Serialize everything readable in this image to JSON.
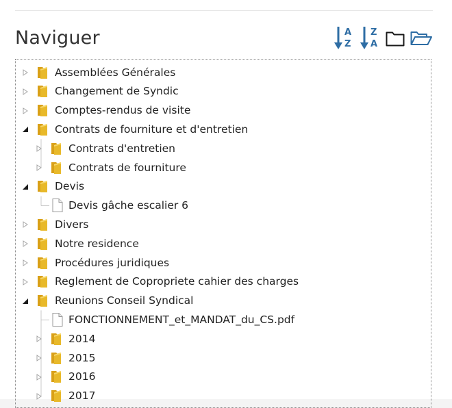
{
  "header": {
    "title": "Naviguer",
    "sort_az": {
      "top": "A",
      "bottom": "Z",
      "icon": "sort-alpha-asc-icon"
    },
    "sort_za": {
      "top": "Z",
      "bottom": "A",
      "icon": "sort-alpha-desc-icon"
    },
    "collapse_icon": "folder-closed-icon",
    "expand_icon": "folder-open-icon"
  },
  "colors": {
    "accent": "#2e6da4",
    "folder": "#e8b92a",
    "text": "#222222"
  },
  "tree": {
    "nodes": [
      {
        "label": "Assemblées Générales",
        "type": "folder",
        "depth": 0,
        "state": "collapsed"
      },
      {
        "label": "Changement de Syndic",
        "type": "folder",
        "depth": 0,
        "state": "collapsed"
      },
      {
        "label": "Comptes-rendus de visite",
        "type": "folder",
        "depth": 0,
        "state": "collapsed"
      },
      {
        "label": "Contrats de fourniture et d'entretien",
        "type": "folder",
        "depth": 0,
        "state": "expanded"
      },
      {
        "label": "Contrats d'entretien",
        "type": "folder",
        "depth": 1,
        "state": "collapsed"
      },
      {
        "label": "Contrats de fourniture",
        "type": "folder",
        "depth": 1,
        "state": "collapsed"
      },
      {
        "label": "Devis",
        "type": "folder",
        "depth": 0,
        "state": "expanded"
      },
      {
        "label": "Devis gâche escalier 6",
        "type": "file",
        "depth": 1,
        "state": "leaf"
      },
      {
        "label": "Divers",
        "type": "folder",
        "depth": 0,
        "state": "collapsed"
      },
      {
        "label": "Notre residence",
        "type": "folder",
        "depth": 0,
        "state": "collapsed"
      },
      {
        "label": "Procédures juridiques",
        "type": "folder",
        "depth": 0,
        "state": "collapsed"
      },
      {
        "label": "Reglement de Copropriete cahier des charges",
        "type": "folder",
        "depth": 0,
        "state": "collapsed"
      },
      {
        "label": "Reunions Conseil Syndical",
        "type": "folder",
        "depth": 0,
        "state": "expanded"
      },
      {
        "label": "FONCTIONNEMENT_et_MANDAT_du_CS.pdf",
        "type": "file",
        "depth": 1,
        "state": "leaf"
      },
      {
        "label": "2014",
        "type": "folder",
        "depth": 1,
        "state": "collapsed"
      },
      {
        "label": "2015",
        "type": "folder",
        "depth": 1,
        "state": "collapsed"
      },
      {
        "label": "2016",
        "type": "folder",
        "depth": 1,
        "state": "collapsed"
      },
      {
        "label": "2017",
        "type": "folder",
        "depth": 1,
        "state": "collapsed"
      }
    ]
  }
}
